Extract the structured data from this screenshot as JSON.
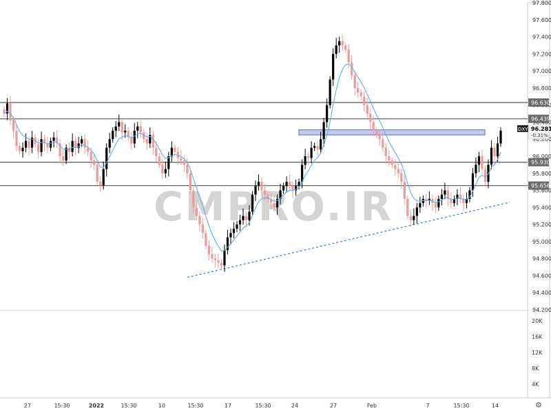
{
  "chart_data": {
    "type": "candlestick",
    "symbol": "DXY",
    "last_price": "96.281",
    "change_pct": "-0.31%",
    "watermark": "CMPRO.IR",
    "colors": {
      "up": "#000000",
      "down": "#ef9a9a",
      "ma": "#5ab0e6",
      "level": "#666666",
      "trendline": "#3d7ab8",
      "zone_fill": "#c5cae9",
      "zone_border": "#5c6bc0",
      "grid": "#eeeeee",
      "background": "#ffffff"
    },
    "y_ticks": [
      "97.800",
      "97.600",
      "97.400",
      "97.200",
      "97.000",
      "96.800",
      "96.600",
      "96.400",
      "96.200",
      "96.000",
      "95.800",
      "95.600",
      "95.400",
      "95.200",
      "95.000",
      "94.800",
      "94.600",
      "94.400",
      "94.200"
    ],
    "ylim": [
      94.2,
      97.8
    ],
    "volume_ticks": [
      "20K",
      "16K",
      "12K",
      "8K",
      "4K"
    ],
    "x_ticks": [
      "27",
      "15:30",
      "2022",
      "15:30",
      "10",
      "15:30",
      "17",
      "15:30",
      "24",
      "27",
      "Feb",
      "7",
      "15:30",
      "14"
    ],
    "levels": [
      {
        "label": "96.630",
        "value": 96.63
      },
      {
        "label": "96.439",
        "value": 96.439
      },
      {
        "label": "95.930",
        "value": 95.93
      },
      {
        "label": "95.656",
        "value": 95.656
      }
    ],
    "zone": {
      "low": 96.25,
      "high": 96.31
    },
    "trendline": {
      "start": 94.58,
      "end": 95.46
    },
    "series": [
      {
        "name": "DXY",
        "close": [
          96.5,
          96.62,
          96.42,
          96.3,
          96.12,
          96.06,
          96.1,
          96.18,
          96.1,
          96.22,
          96.14,
          96.05,
          96.2,
          96.15,
          96.1,
          96.18,
          96.22,
          96.15,
          96.0,
          95.95,
          96.1,
          96.05,
          96.18,
          96.1,
          96.15,
          96.2,
          96.1,
          96.05,
          95.95,
          95.9,
          95.7,
          95.66,
          95.85,
          96.1,
          96.2,
          96.3,
          96.35,
          96.4,
          96.28,
          96.3,
          96.22,
          96.15,
          96.3,
          96.35,
          96.28,
          96.2,
          96.15,
          96.25,
          96.1,
          96.0,
          95.9,
          95.8,
          95.85,
          96.0,
          96.1,
          96.05,
          95.98,
          95.95,
          95.9,
          95.8,
          95.6,
          95.4,
          95.3,
          95.2,
          95.1,
          94.95,
          94.85,
          94.8,
          94.78,
          94.75,
          94.72,
          94.9,
          95.05,
          95.1,
          95.15,
          95.2,
          95.25,
          95.3,
          95.25,
          95.35,
          95.55,
          95.65,
          95.7,
          95.6,
          95.55,
          95.5,
          95.45,
          95.4,
          95.5,
          95.6,
          95.65,
          95.7,
          95.65,
          95.6,
          95.65,
          95.7,
          95.9,
          96.0,
          95.98,
          96.1,
          96.12,
          96.08,
          96.2,
          96.4,
          96.6,
          96.9,
          97.2,
          97.3,
          97.35,
          97.3,
          97.25,
          97.1,
          96.95,
          96.8,
          96.75,
          96.7,
          96.6,
          96.5,
          96.4,
          96.3,
          96.25,
          96.2,
          96.1,
          96.0,
          95.95,
          95.9,
          95.85,
          95.8,
          95.7,
          95.5,
          95.3,
          95.25,
          95.3,
          95.4,
          95.45,
          95.5,
          95.48,
          95.5,
          95.45,
          95.4,
          95.5,
          95.55,
          95.6,
          95.5,
          95.45,
          95.5,
          95.55,
          95.5,
          95.45,
          95.5,
          95.6,
          95.8,
          95.9,
          96.0,
          95.85,
          95.7,
          95.9,
          96.1,
          96.0,
          96.15,
          96.3
        ]
      }
    ]
  }
}
